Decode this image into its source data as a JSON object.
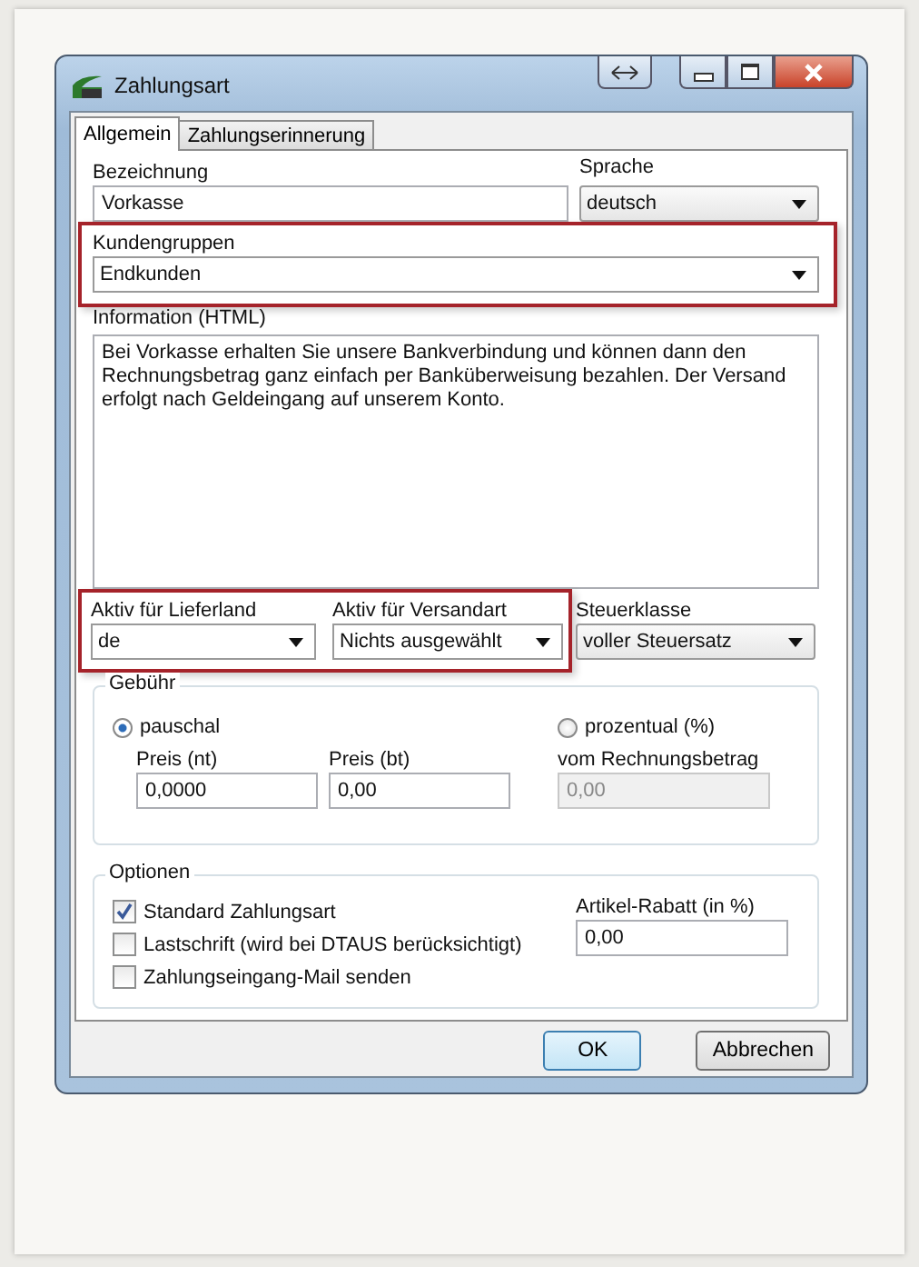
{
  "window": {
    "title": "Zahlungsart"
  },
  "tabs": [
    {
      "label": "Allgemein",
      "selected": true
    },
    {
      "label": "Zahlungserinnerung",
      "selected": false
    }
  ],
  "bezeichnung": {
    "label": "Bezeichnung",
    "value": "Vorkasse"
  },
  "sprache": {
    "label": "Sprache",
    "value": "deutsch"
  },
  "kundengruppen": {
    "label": "Kundengruppen",
    "value": "Endkunden",
    "highlighted": true
  },
  "information": {
    "label": "Information (HTML)",
    "value": "Bei Vorkasse erhalten Sie unsere Bankverbindung und können dann den Rechnungsbetrag ganz einfach per Banküberweisung bezahlen. Der Versand erfolgt nach Geldeingang auf unserem Konto."
  },
  "delivery": {
    "highlighted": true,
    "fields": [
      {
        "label": "Aktiv für Lieferland",
        "value": "de"
      },
      {
        "label": "Aktiv für Versandart",
        "value": "Nichts ausgewählt"
      }
    ]
  },
  "steuerklasse": {
    "label": "Steuerklasse",
    "value": "voller Steuersatz"
  },
  "gebuehr": {
    "title": "Gebühr",
    "options": [
      {
        "label": "pauschal",
        "selected": true,
        "fields": [
          {
            "label": "Preis (nt)",
            "value": "0,0000",
            "disabled": false
          },
          {
            "label": "Preis (bt)",
            "value": "0,00",
            "disabled": false
          }
        ]
      },
      {
        "label": "prozentual (%)",
        "selected": false,
        "fields": [
          {
            "label": "vom Rechnungsbetrag",
            "value": "0,00",
            "disabled": true
          }
        ]
      }
    ]
  },
  "optionen": {
    "title": "Optionen",
    "checkboxes": [
      {
        "label": "Standard Zahlungsart",
        "checked": true
      },
      {
        "label": "Lastschrift (wird bei DTAUS berücksichtigt)",
        "checked": false
      },
      {
        "label": "Zahlungseingang-Mail senden",
        "checked": false
      }
    ],
    "rabatt": {
      "label": "Artikel-Rabatt (in %)",
      "value": "0,00"
    }
  },
  "buttons": [
    {
      "label": "OK",
      "default": true
    },
    {
      "label": "Abbrechen",
      "default": false
    }
  ]
}
